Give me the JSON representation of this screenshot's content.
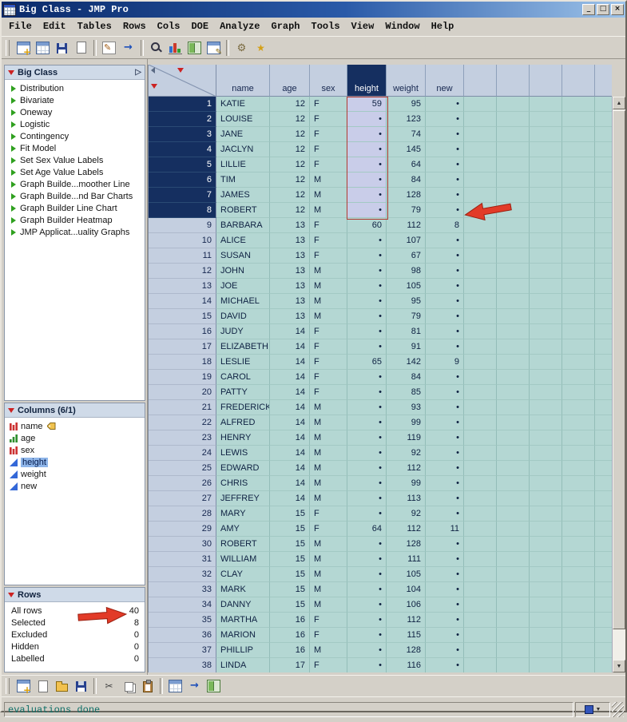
{
  "window": {
    "title": "Big Class - JMP Pro",
    "buttons": {
      "minimize": "_",
      "maximize": "□",
      "close": "×"
    }
  },
  "menu": {
    "items": [
      "File",
      "Edit",
      "Tables",
      "Rows",
      "Cols",
      "DOE",
      "Analyze",
      "Graph",
      "Tools",
      "View",
      "Window",
      "Help"
    ]
  },
  "toolbar_top": {
    "items": [
      {
        "base": "new-data-table",
        "icon": "table-plus"
      },
      {
        "base": "open-data-table",
        "icon": "table"
      },
      {
        "base": "save-data-table",
        "icon": "disk"
      },
      {
        "base": "print-table",
        "icon": "page"
      },
      {
        "base": "sep1",
        "icon": "sep"
      },
      {
        "base": "edit-script",
        "icon": "pencilpage"
      },
      {
        "base": "run-script",
        "icon": "arrow"
      },
      {
        "base": "sep2",
        "icon": "sep"
      },
      {
        "base": "search",
        "icon": "search"
      },
      {
        "base": "summary-statistics",
        "icon": "bars"
      },
      {
        "base": "table-panels",
        "icon": "panels"
      },
      {
        "base": "column-info",
        "icon": "table-pencil"
      },
      {
        "base": "sep3",
        "icon": "sep"
      },
      {
        "base": "preferences",
        "icon": "gear"
      },
      {
        "base": "favorites",
        "icon": "star"
      }
    ]
  },
  "sidebar": {
    "table_panel": {
      "title": "Big Class",
      "items": [
        "Distribution",
        "Bivariate",
        "Oneway",
        "Logistic",
        "Contingency",
        "Fit Model",
        "Set Sex Value Labels",
        "Set Age Value Labels",
        "Graph Builde...moother Line",
        "Graph Builde...nd Bar Charts",
        "Graph Builder Line Chart",
        "Graph Builder Heatmap",
        "JMP Applicat...uality Graphs"
      ]
    },
    "columns_panel": {
      "title": "Columns (6/1)",
      "items": [
        {
          "label": "name",
          "type": "nominal",
          "tag": true
        },
        {
          "label": "age",
          "type": "ordinal"
        },
        {
          "label": "sex",
          "type": "nominal"
        },
        {
          "label": "height",
          "type": "continuous",
          "selected": true
        },
        {
          "label": "weight",
          "type": "continuous"
        },
        {
          "label": "new",
          "type": "continuous"
        }
      ]
    },
    "rows_panel": {
      "title": "Rows",
      "stats": [
        {
          "label": "All rows",
          "value": "40"
        },
        {
          "label": "Selected",
          "value": "8"
        },
        {
          "label": "Excluded",
          "value": "0"
        },
        {
          "label": "Hidden",
          "value": "0"
        },
        {
          "label": "Labelled",
          "value": "0"
        }
      ]
    }
  },
  "table": {
    "columns": [
      "name",
      "age",
      "sex",
      "height",
      "weight",
      "new"
    ],
    "selected_column": "height",
    "missing_marker": "•",
    "selected_rows": [
      1,
      2,
      3,
      4,
      5,
      6,
      7,
      8
    ],
    "height_highlight_rows": [
      1,
      2,
      3,
      4,
      5,
      6,
      7,
      8
    ],
    "empty_columns": 4,
    "rows": [
      [
        1,
        "KATIE",
        12,
        "F",
        "59",
        95,
        "•"
      ],
      [
        2,
        "LOUISE",
        12,
        "F",
        "•",
        123,
        "•"
      ],
      [
        3,
        "JANE",
        12,
        "F",
        "•",
        74,
        "•"
      ],
      [
        4,
        "JACLYN",
        12,
        "F",
        "•",
        145,
        "•"
      ],
      [
        5,
        "LILLIE",
        12,
        "F",
        "•",
        64,
        "•"
      ],
      [
        6,
        "TIM",
        12,
        "M",
        "•",
        84,
        "•"
      ],
      [
        7,
        "JAMES",
        12,
        "M",
        "•",
        128,
        "•"
      ],
      [
        8,
        "ROBERT",
        12,
        "M",
        "•",
        79,
        "•"
      ],
      [
        9,
        "BARBARA",
        13,
        "F",
        "60",
        112,
        "8"
      ],
      [
        10,
        "ALICE",
        13,
        "F",
        "•",
        107,
        "•"
      ],
      [
        11,
        "SUSAN",
        13,
        "F",
        "•",
        67,
        "•"
      ],
      [
        12,
        "JOHN",
        13,
        "M",
        "•",
        98,
        "•"
      ],
      [
        13,
        "JOE",
        13,
        "M",
        "•",
        105,
        "•"
      ],
      [
        14,
        "MICHAEL",
        13,
        "M",
        "•",
        95,
        "•"
      ],
      [
        15,
        "DAVID",
        13,
        "M",
        "•",
        79,
        "•"
      ],
      [
        16,
        "JUDY",
        14,
        "F",
        "•",
        81,
        "•"
      ],
      [
        17,
        "ELIZABETH",
        14,
        "F",
        "•",
        91,
        "•"
      ],
      [
        18,
        "LESLIE",
        14,
        "F",
        "65",
        142,
        "9"
      ],
      [
        19,
        "CAROL",
        14,
        "F",
        "•",
        84,
        "•"
      ],
      [
        20,
        "PATTY",
        14,
        "F",
        "•",
        85,
        "•"
      ],
      [
        21,
        "FREDERICK",
        14,
        "M",
        "•",
        93,
        "•"
      ],
      [
        22,
        "ALFRED",
        14,
        "M",
        "•",
        99,
        "•"
      ],
      [
        23,
        "HENRY",
        14,
        "M",
        "•",
        119,
        "•"
      ],
      [
        24,
        "LEWIS",
        14,
        "M",
        "•",
        92,
        "•"
      ],
      [
        25,
        "EDWARD",
        14,
        "M",
        "•",
        112,
        "•"
      ],
      [
        26,
        "CHRIS",
        14,
        "M",
        "•",
        99,
        "•"
      ],
      [
        27,
        "JEFFREY",
        14,
        "M",
        "•",
        113,
        "•"
      ],
      [
        28,
        "MARY",
        15,
        "F",
        "•",
        92,
        "•"
      ],
      [
        29,
        "AMY",
        15,
        "F",
        "64",
        112,
        "11"
      ],
      [
        30,
        "ROBERT",
        15,
        "M",
        "•",
        128,
        "•"
      ],
      [
        31,
        "WILLIAM",
        15,
        "M",
        "•",
        111,
        "•"
      ],
      [
        32,
        "CLAY",
        15,
        "M",
        "•",
        105,
        "•"
      ],
      [
        33,
        "MARK",
        15,
        "M",
        "•",
        104,
        "•"
      ],
      [
        34,
        "DANNY",
        15,
        "M",
        "•",
        106,
        "•"
      ],
      [
        35,
        "MARTHA",
        16,
        "F",
        "•",
        112,
        "•"
      ],
      [
        36,
        "MARION",
        16,
        "F",
        "•",
        115,
        "•"
      ],
      [
        37,
        "PHILLIP",
        16,
        "M",
        "•",
        128,
        "•"
      ],
      [
        38,
        "LINDA",
        17,
        "F",
        "•",
        116,
        "•"
      ]
    ]
  },
  "toolbar_bottom": {
    "items": [
      {
        "base": "new-data-table",
        "icon": "table-plus"
      },
      {
        "base": "new-journal",
        "icon": "page"
      },
      {
        "base": "open-file",
        "icon": "folder"
      },
      {
        "base": "save-file",
        "icon": "disk"
      },
      {
        "base": "sep1",
        "icon": "sep"
      },
      {
        "base": "cut",
        "icon": "scissors"
      },
      {
        "base": "copy",
        "icon": "copy"
      },
      {
        "base": "paste",
        "icon": "paste"
      },
      {
        "base": "sep2",
        "icon": "sep"
      },
      {
        "base": "copy-table",
        "icon": "table"
      },
      {
        "base": "export-table",
        "icon": "arrow"
      },
      {
        "base": "layout",
        "icon": "panels"
      }
    ]
  },
  "statusbar": {
    "text": "evaluations done"
  },
  "colors": {
    "selection_navy": "#152f60",
    "table_cell_teal": "#b4d7d3",
    "column_highlight_lavender": "#c9cde9",
    "annotation_red": "#e23b28",
    "titlebar_blue": "#0a2a6a"
  }
}
